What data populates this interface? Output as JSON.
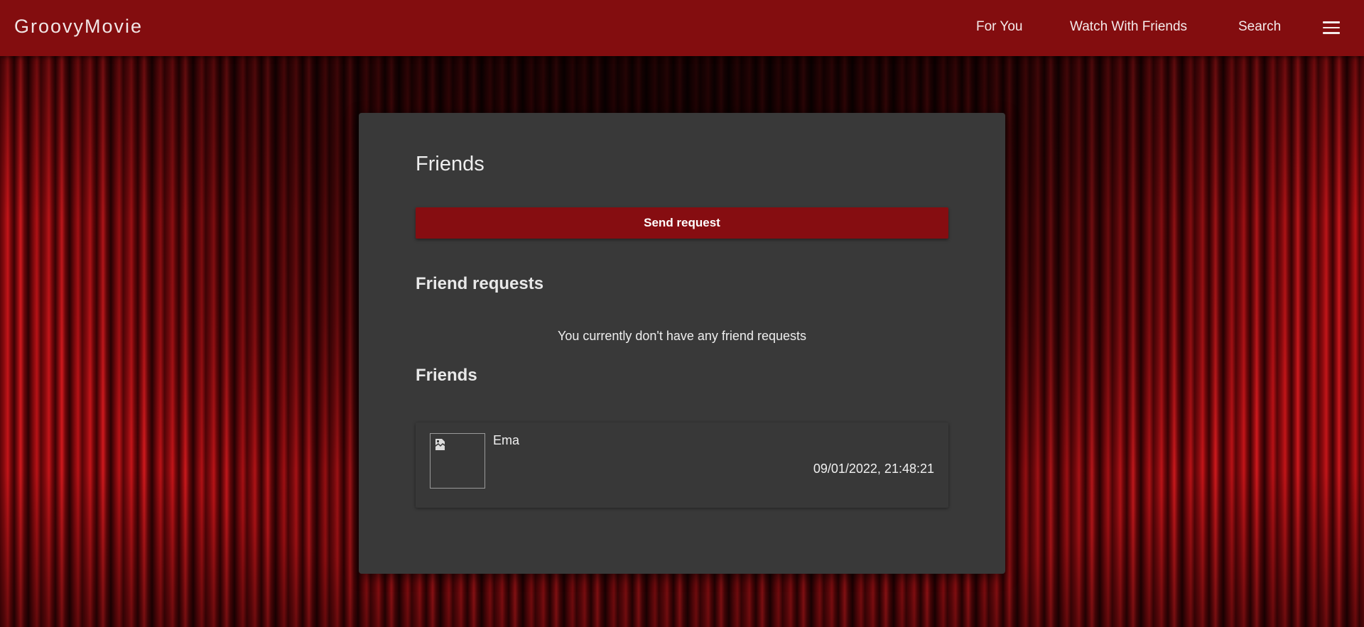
{
  "header": {
    "brand": "GroovyMovie",
    "nav": {
      "for_you": "For You",
      "watch_with_friends": "Watch With Friends",
      "search": "Search"
    },
    "menu_icon": "hamburger-menu-icon"
  },
  "colors": {
    "topbar": "#830d0f",
    "button": "#860d11",
    "card": "#393939"
  },
  "page": {
    "title": "Friends",
    "send_request_label": "Send request",
    "friend_requests": {
      "heading": "Friend requests",
      "empty_text": "You currently don't have any friend requests"
    },
    "friends": {
      "heading": "Friends",
      "items": [
        {
          "name": "Ema",
          "date": "09/01/2022, 21:48:21",
          "avatar_icon": "broken-image-icon"
        }
      ]
    }
  }
}
